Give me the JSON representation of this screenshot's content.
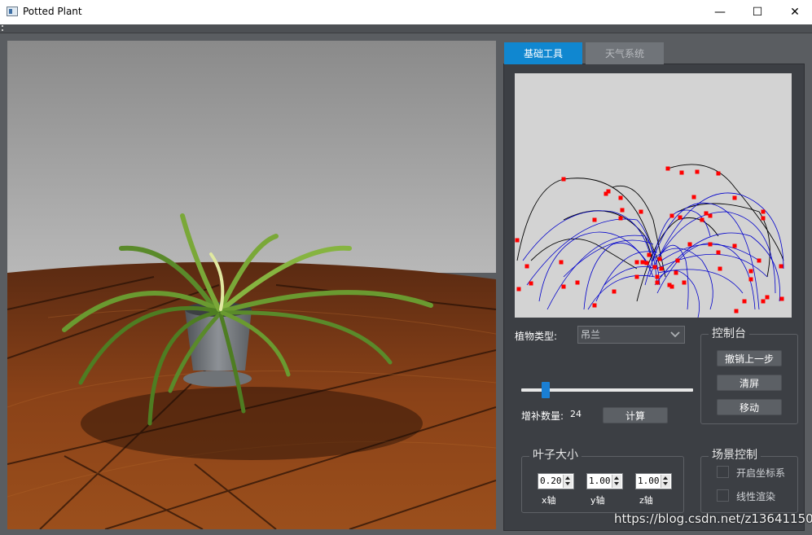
{
  "window": {
    "title": "Potted Plant",
    "minimize": "—",
    "maximize": "☐",
    "close": "✕"
  },
  "tabs": [
    {
      "label": "基础工具",
      "active": true
    },
    {
      "label": "天气系统",
      "active": false
    }
  ],
  "plant_type": {
    "label": "植物类型:",
    "value": "吊兰"
  },
  "control_panel": {
    "title": "控制台",
    "undo": "撤销上一步",
    "clear": "清屏",
    "move": "移动"
  },
  "slider": {
    "level": 0.14
  },
  "count": {
    "label": "增补数量:",
    "value": "24"
  },
  "compute_button": "计算",
  "leaf_size": {
    "title": "叶子大小",
    "x_value": "0.20",
    "y_value": "1.00",
    "z_value": "1.00",
    "x_label": "x轴",
    "y_label": "y轴",
    "z_label": "z轴"
  },
  "scene_control": {
    "title": "场景控制",
    "coords": "开启坐标系",
    "wireframe": "线性渲染"
  },
  "watermark": "https://blog.csdn.net/z136411501",
  "colors": {
    "accent": "#1087d0",
    "control_point": "#ff0000",
    "curve_blue": "#0000cc",
    "curve_black": "#000000"
  },
  "icons": {
    "chevron": "chevron-down-icon"
  }
}
